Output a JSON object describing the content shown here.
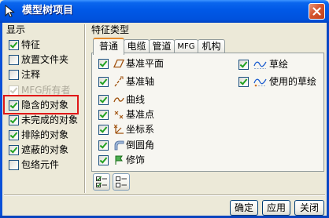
{
  "window": {
    "title": "模型树项目",
    "app_icon": "cursor-arrow-icon",
    "close_icon": "close-icon"
  },
  "display": {
    "label": "显示",
    "items": [
      {
        "label": "特征",
        "checked": true,
        "disabled": false
      },
      {
        "label": "放置文件夹",
        "checked": false,
        "disabled": false
      },
      {
        "label": "注释",
        "checked": false,
        "disabled": false
      },
      {
        "label": "MFG所有者",
        "checked": true,
        "disabled": true
      },
      {
        "label": "隐含的对象",
        "checked": true,
        "disabled": false,
        "highlighted": true
      },
      {
        "label": "未完成的对象",
        "checked": true,
        "disabled": false
      },
      {
        "label": "排除的对象",
        "checked": true,
        "disabled": false
      },
      {
        "label": "遮蔽的对象",
        "checked": true,
        "disabled": false
      },
      {
        "label": "包络元件",
        "checked": false,
        "disabled": false
      }
    ]
  },
  "feature_types": {
    "label": "特征类型",
    "tabs": [
      {
        "label": "普通",
        "active": true
      },
      {
        "label": "电缆",
        "active": false
      },
      {
        "label": "管道",
        "active": false
      },
      {
        "label": "MFG",
        "active": false
      },
      {
        "label": "机构",
        "active": false
      }
    ],
    "left_items": [
      {
        "label": "基准平面",
        "checked": true,
        "icon": "datum-plane-icon"
      },
      {
        "label": "基准轴",
        "checked": true,
        "icon": "datum-axis-icon"
      },
      {
        "label": "曲线",
        "checked": true,
        "icon": "curve-icon"
      },
      {
        "label": "基准点",
        "checked": true,
        "icon": "datum-point-icon"
      },
      {
        "label": "坐标系",
        "checked": true,
        "icon": "coordinate-system-icon"
      },
      {
        "label": "倒圆角",
        "checked": true,
        "icon": "round-icon"
      },
      {
        "label": "修饰",
        "checked": true,
        "icon": "cosmetic-icon"
      }
    ],
    "right_items": [
      {
        "label": "草绘",
        "checked": true,
        "icon": "sketch-icon"
      },
      {
        "label": "使用的草绘",
        "checked": true,
        "icon": "used-sketch-icon"
      }
    ],
    "select_all_icon": "select-all-icon",
    "clear_all_icon": "clear-all-icon"
  },
  "buttons": {
    "ok": "确定",
    "apply": "应用",
    "close": "关闭"
  },
  "colors": {
    "title_bar": "#0058E6",
    "dialog_bg": "#ECE9D8",
    "check_mark": "#21A121",
    "highlight": "#E01818",
    "disabled_text": "#ACA899",
    "feature_icon": "#A0520F",
    "sketch_icon": "#1F5FD0"
  }
}
